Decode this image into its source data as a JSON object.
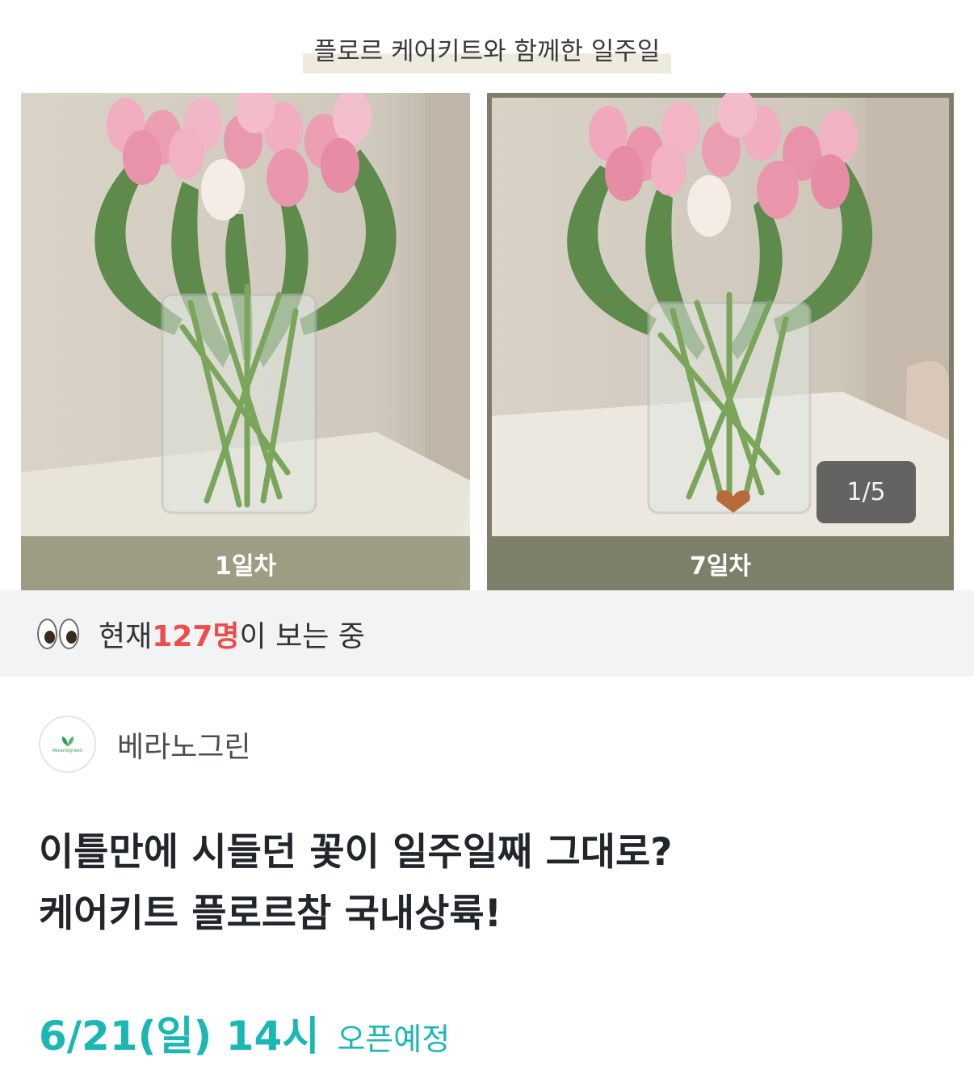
{
  "hero": {
    "caption": "플로르 케어키트와 함께한 일주일",
    "photos": [
      {
        "label": "1일차"
      },
      {
        "label": "7일차"
      }
    ],
    "counter": "1/5"
  },
  "viewers": {
    "prefix": "현재 ",
    "count": "127명",
    "suffix": "이 보는 중"
  },
  "seller": {
    "name": "베라노그린",
    "logo_text": "Veranogreen"
  },
  "product": {
    "title_line1": "이틀만에 시들던 꽃이 일주일째 그대로?",
    "title_line2": "케어키트 플로르참 국내상륙!"
  },
  "open": {
    "date": "6/21(일) 14시",
    "status": "오픈예정"
  },
  "colors": {
    "accent": "#1bb7b2",
    "count_red": "#ef4c4c",
    "label_olive": "#7d7f68"
  }
}
